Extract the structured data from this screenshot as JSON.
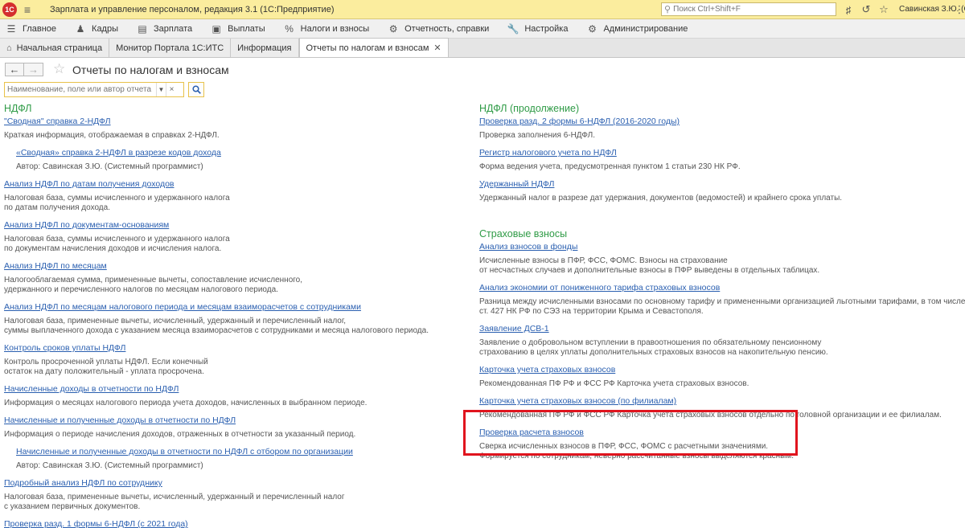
{
  "titlebar": {
    "logo_text": "1С",
    "app_title": "Зарплата и управление персоналом, редакция 3.1  (1С:Предприятие)",
    "search_placeholder": "Поиск Ctrl+Shift+F",
    "user_name": "Савинская З.Ю. (Систе"
  },
  "sections": [
    {
      "label": "Главное",
      "icon": "menu-lines-icon"
    },
    {
      "label": "Кадры",
      "icon": "people-icon"
    },
    {
      "label": "Зарплата",
      "icon": "wallet-icon"
    },
    {
      "label": "Выплаты",
      "icon": "cash-icon"
    },
    {
      "label": "Налоги и взносы",
      "icon": "percent-icon"
    },
    {
      "label": "Отчетность, справки",
      "icon": "gears-icon"
    },
    {
      "label": "Настройка",
      "icon": "wrench-icon"
    },
    {
      "label": "Администрирование",
      "icon": "gear-icon"
    }
  ],
  "tabs": [
    {
      "label": "Начальная страница"
    },
    {
      "label": "Монитор Портала 1С:ИТС"
    },
    {
      "label": "Информация"
    },
    {
      "label": "Отчеты по налогам и взносам"
    }
  ],
  "form": {
    "title": "Отчеты по налогам и взносам",
    "filter_placeholder": "Наименование, поле или автор отчета"
  },
  "left": {
    "groups": [
      {
        "title": "НДФЛ",
        "reports": [
          {
            "link": "\"Сводная\" справка 2-НДФЛ",
            "desc": [
              "Краткая информация, отображаемая в справках 2-НДФЛ."
            ]
          },
          {
            "link": "«Сводная» справка 2-НДФЛ в разрезе кодов дохода",
            "desc": [
              "Автор: Савинская З.Ю. (Системный программист)"
            ],
            "sub": true
          },
          {
            "link": "Анализ НДФЛ по датам получения доходов",
            "desc": [
              "Налоговая база, суммы исчисленного и удержанного налога",
              "по датам получения дохода."
            ]
          },
          {
            "link": "Анализ НДФЛ по документам-основаниям",
            "desc": [
              "Налоговая база, суммы исчисленного и удержанного налога",
              "по документам начисления доходов и исчисления налога."
            ]
          },
          {
            "link": "Анализ НДФЛ по месяцам",
            "desc": [
              "Налогооблагаемая сумма, примененные вычеты, сопоставление исчисленного,",
              "удержанного и перечисленного налогов по месяцам налогового периода."
            ]
          },
          {
            "link": "Анализ НДФЛ по месяцам налогового периода и месяцам взаиморасчетов с сотрудниками",
            "desc": [
              "Налоговая база, примененные вычеты, исчисленный, удержанный и перечисленный налог,",
              "суммы выплаченного дохода с указанием месяца взаиморасчетов с сотрудниками и месяца налогового периода."
            ]
          },
          {
            "link": "Контроль сроков уплаты НДФЛ",
            "desc": [
              "Контроль просроченной уплаты НДФЛ. Если конечный",
              "остаток на дату положительный - уплата просрочена."
            ]
          },
          {
            "link": "Начисленные доходы в отчетности по НДФЛ",
            "desc": [
              "Информация о месяцах налогового периода учета доходов, начисленных в выбранном периоде."
            ]
          },
          {
            "link": "Начисленные и полученные доходы в отчетности по НДФЛ",
            "desc": [
              "Информация о периоде начисления доходов, отраженных в отчетности за указанный период."
            ]
          },
          {
            "link": "Начисленные и полученные доходы в отчетности по НДФЛ с отбором по организации",
            "desc": [
              "Автор: Савинская З.Ю. (Системный программист)"
            ],
            "sub": true
          },
          {
            "link": "Подробный анализ НДФЛ по сотруднику",
            "desc": [
              "Налоговая база, примененные вычеты, исчисленный, удержанный и перечисленный налог",
              "с указанием первичных документов."
            ]
          },
          {
            "link": "Проверка разд. 1 формы 6-НДФЛ (с 2021 года)",
            "desc": []
          }
        ]
      }
    ]
  },
  "right": {
    "groups": [
      {
        "title": "НДФЛ (продолжение)",
        "reports": [
          {
            "link": "Проверка разд. 2 формы 6-НДФЛ (2016-2020 годы)",
            "desc": [
              "Проверка заполнения 6-НДФЛ."
            ]
          },
          {
            "link": "Регистр налогового учета по НДФЛ",
            "desc": [
              "Форма ведения учета, предусмотренная пунктом 1 статьи 230 НК РФ."
            ]
          },
          {
            "link": "Удержанный НДФЛ",
            "desc": [
              "Удержанный налог в разрезе дат удержания, документов (ведомостей) и крайнего срока уплаты."
            ]
          }
        ]
      },
      {
        "title": "Страховые взносы",
        "reports": [
          {
            "link": "Анализ взносов в фонды",
            "desc": [
              "Исчисленные взносы в ПФР, ФСС, ФОМС. Взносы на страхование",
              "от несчастных случаев и дополнительные взносы в ПФР выведены в отдельных таблицах."
            ]
          },
          {
            "link": "Анализ экономии от пониженного тарифа страховых взносов",
            "desc": [
              "Разница между исчисленными взносами по основному тарифу и примененными организацией льготными тарифами, в том числе для контр",
              "ст. 427 НК РФ по СЭЗ на территории Крыма и Севастополя."
            ]
          },
          {
            "link": "Заявление ДСВ-1",
            "desc": [
              "Заявление о добровольном вступлении в правоотношения по обязательному пенсионному",
              "страхованию в целях уплаты дополнительных страховых взносов на накопительную пенсию."
            ]
          },
          {
            "link": "Карточка учета страховых взносов",
            "desc": [
              "Рекомендованная ПФ РФ и ФСС РФ Карточка учета страховых взносов."
            ]
          },
          {
            "link": "Карточка учета страховых взносов (по филиалам)",
            "desc": [
              "Рекомендованная ПФ РФ и ФСС РФ Карточка учета страховых взносов отдельно по головной организации и ее филиалам."
            ]
          },
          {
            "link": "Проверка расчета взносов",
            "desc": [
              "Сверка исчисленных взносов в ПФР, ФСС, ФОМС с расчетными значениями.",
              "Формируется по сотрудникам, неверно рассчитанные взносы выделяются красным."
            ]
          }
        ]
      }
    ]
  }
}
